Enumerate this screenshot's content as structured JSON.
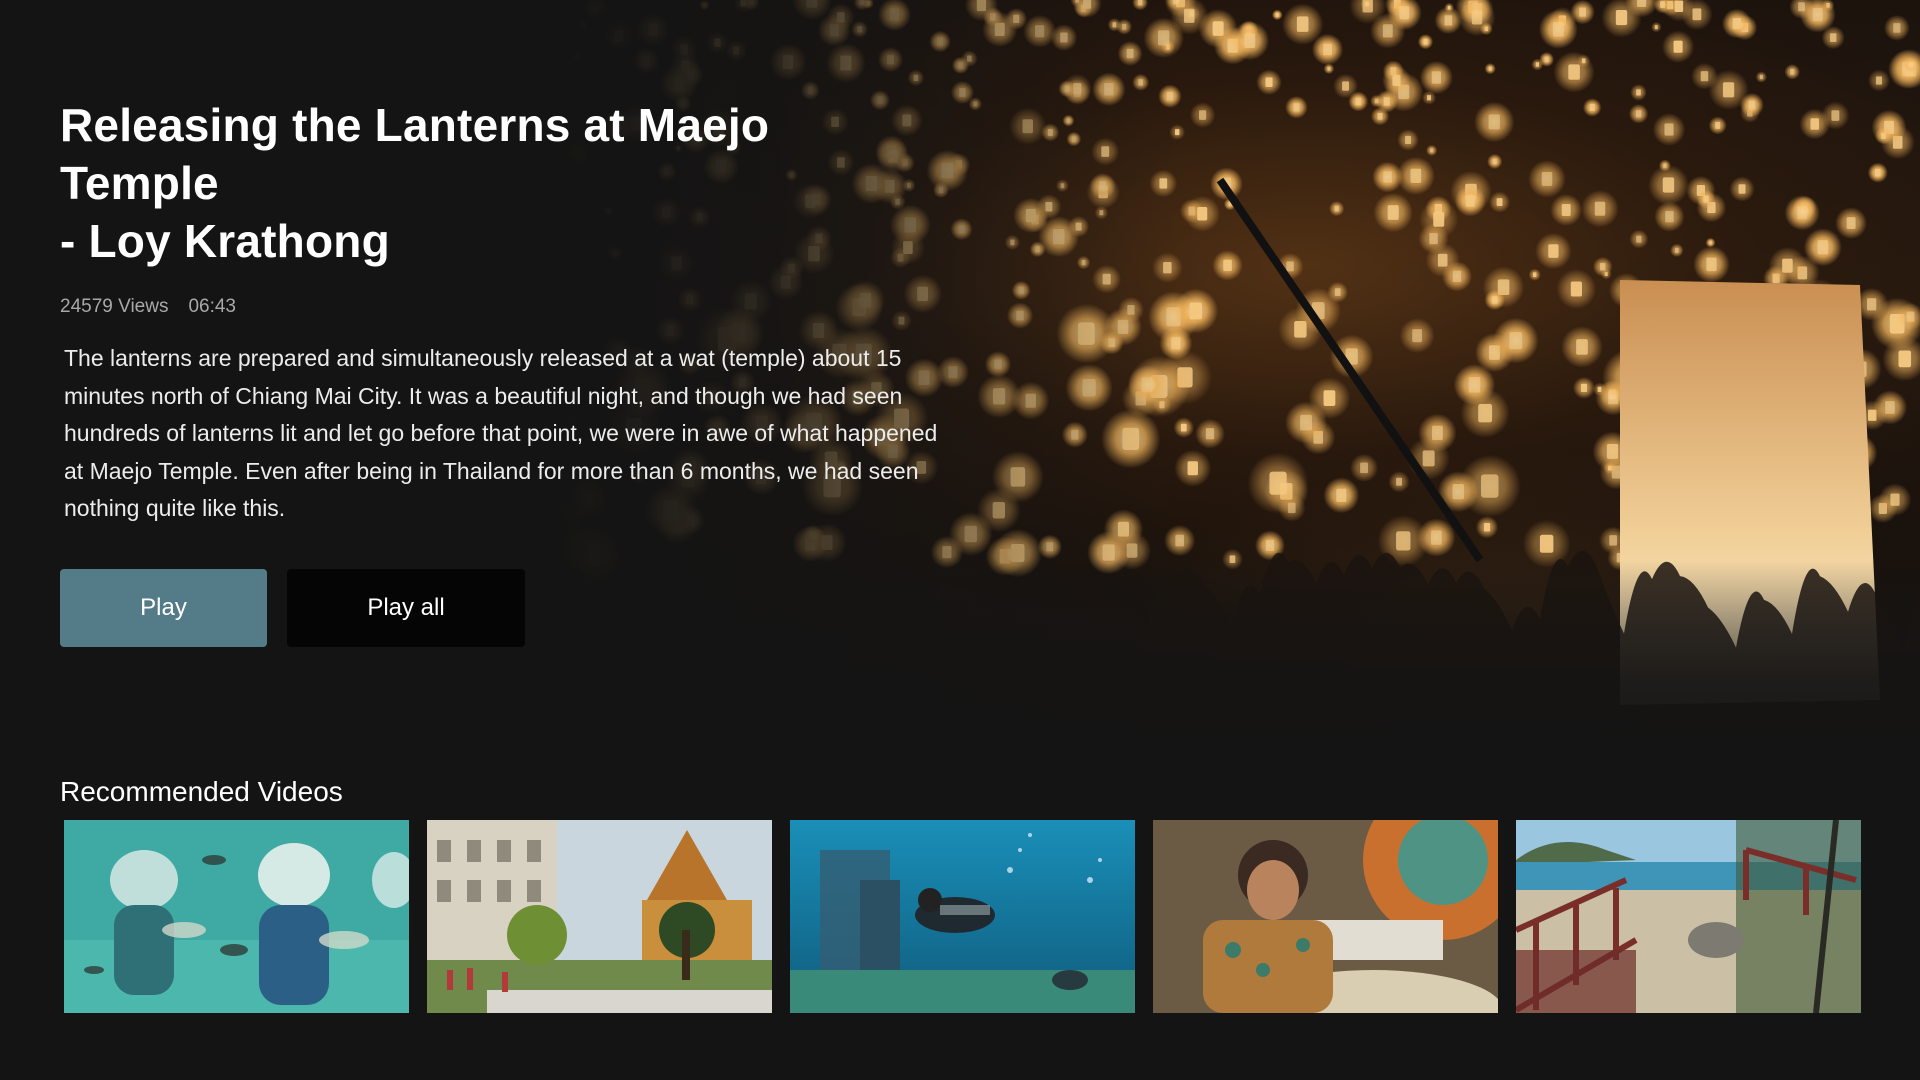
{
  "hero": {
    "title_line1": "Releasing the Lanterns at Maejo Temple",
    "title_line2": "- Loy Krathong",
    "views": "24579 Views",
    "duration": "06:43",
    "description": "The lanterns are prepared and simultaneously released at a wat (temple) about 15 minutes north of Chiang Mai City. It was a beautiful night, and though we had seen hundreds of lanterns lit and let go before that point, we were in awe of what happened at Maejo Temple. Even after being in Thailand for more than 6 months, we had seen nothing quite like this.",
    "image": "lantern-festival-night-scene"
  },
  "actions": {
    "play_label": "Play",
    "play_all_label": "Play all"
  },
  "recommended": {
    "heading": "Recommended Videos",
    "items": [
      {
        "image": "underwater-helmet-divers"
      },
      {
        "image": "bangkok-grand-palace-garden"
      },
      {
        "image": "scuba-diver-reef"
      },
      {
        "image": "umbrella-painting-artisan"
      },
      {
        "image": "island-beach-wooden-bridge"
      }
    ]
  },
  "colors": {
    "background": "#141414",
    "play_button": "#547c88",
    "play_all_button": "#050505",
    "meta_text": "#a8a8a8"
  }
}
